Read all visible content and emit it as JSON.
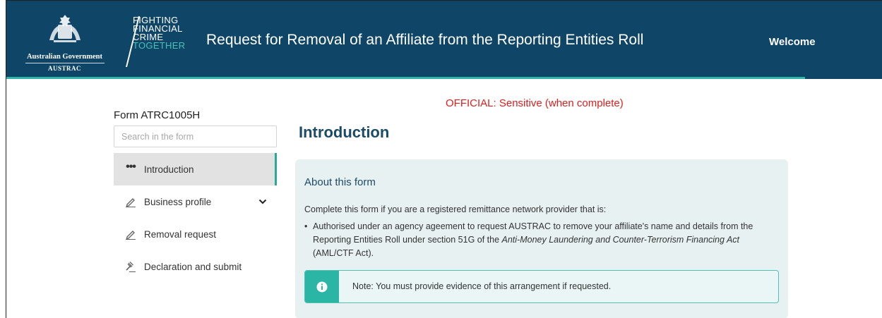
{
  "header": {
    "gov_name": "Australian Government",
    "agency": "AUSTRAC",
    "campaign_lines": [
      "FIGHTING",
      "FINANCIAL",
      "CRIME",
      "TOGETHER"
    ],
    "title": "Request for Removal of an Affiliate from the Reporting Entities Roll",
    "welcome": "Welcome"
  },
  "classification": "OFFICIAL: Sensitive (when complete)",
  "sidebar": {
    "form_id": "Form ATRC1005H",
    "search_placeholder": "Search in the form",
    "items": [
      {
        "label": "Introduction",
        "icon": "more-dots-icon",
        "active": true
      },
      {
        "label": "Business profile",
        "icon": "pencil-icon",
        "expandable": true
      },
      {
        "label": "Removal request",
        "icon": "pencil-icon"
      },
      {
        "label": "Declaration and submit",
        "icon": "gavel-icon"
      }
    ]
  },
  "main": {
    "heading": "Introduction",
    "card": {
      "title": "About this form",
      "intro": "Complete this form if you are a registered remittance network provider that is:",
      "bullet_text": "Authorised under an agency ageement to request AUSTRAC to remove your affiliate's name and details from the Reporting Entities Roll under section 51G of the ",
      "bullet_act": "Anti-Money Laundering and Counter-Terrorism Financing Act",
      "bullet_suffix": " (AML/CTF Act).",
      "note": "Note: You must provide evidence of this arrangement if requested."
    }
  },
  "colors": {
    "header_bg": "#0f4668",
    "accent_teal": "#2bb5a4",
    "classification_red": "#e21b1b",
    "heading_blue": "#1c4b68",
    "card_bg": "#e8f1f1"
  }
}
